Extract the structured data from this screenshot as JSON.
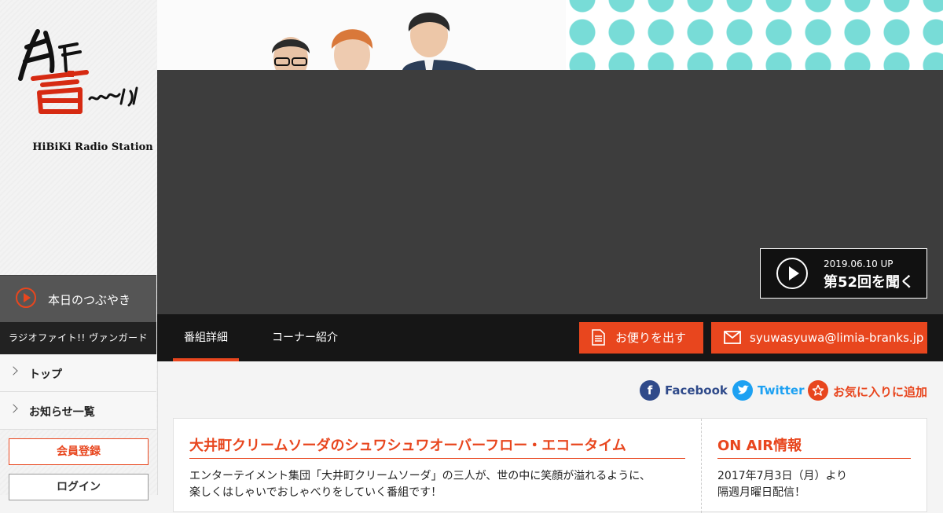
{
  "brand": {
    "logo_text": "響 HiBiKi",
    "station_name": "HiBiKi Radio Station"
  },
  "sidebar": {
    "tweet_label": "本日のつぶやき",
    "program_name": "ラジオファイト!! ヴァンガード",
    "nav": [
      {
        "label": "トップ"
      },
      {
        "label": "お知らせ一覧"
      }
    ],
    "register_label": "会員登録",
    "login_label": "ログイン"
  },
  "player": {
    "date": "2019.06.10 UP",
    "listen_label": "第52回を聞く"
  },
  "tabs": {
    "detail": "番組詳細",
    "corner": "コーナー紹介",
    "letter_button": "お便りを出す",
    "email": "syuwasyuwa@limia-branks.jp"
  },
  "share": {
    "facebook": "Facebook",
    "twitter": "Twitter",
    "favorite": "お気に入りに追加"
  },
  "program": {
    "title": "大井町クリームソーダのシュワシュワオーバーフロー・エコータイム",
    "description_line1": "エンターテイメント集団「大井町クリームソーダ」の三人が、世の中に笑顔が溢れるように、",
    "description_line2": "楽しくはしゃいでおしゃべりをしていく番組です！"
  },
  "onair": {
    "title": "ON AIR情報",
    "line1": "2017年7月3日（月）より",
    "line2": "隔週月曜日配信！"
  },
  "colors": {
    "accent": "#e8461e",
    "facebook": "#2f4a8a",
    "twitter": "#1da1f2",
    "dots": "#78dcd7"
  }
}
